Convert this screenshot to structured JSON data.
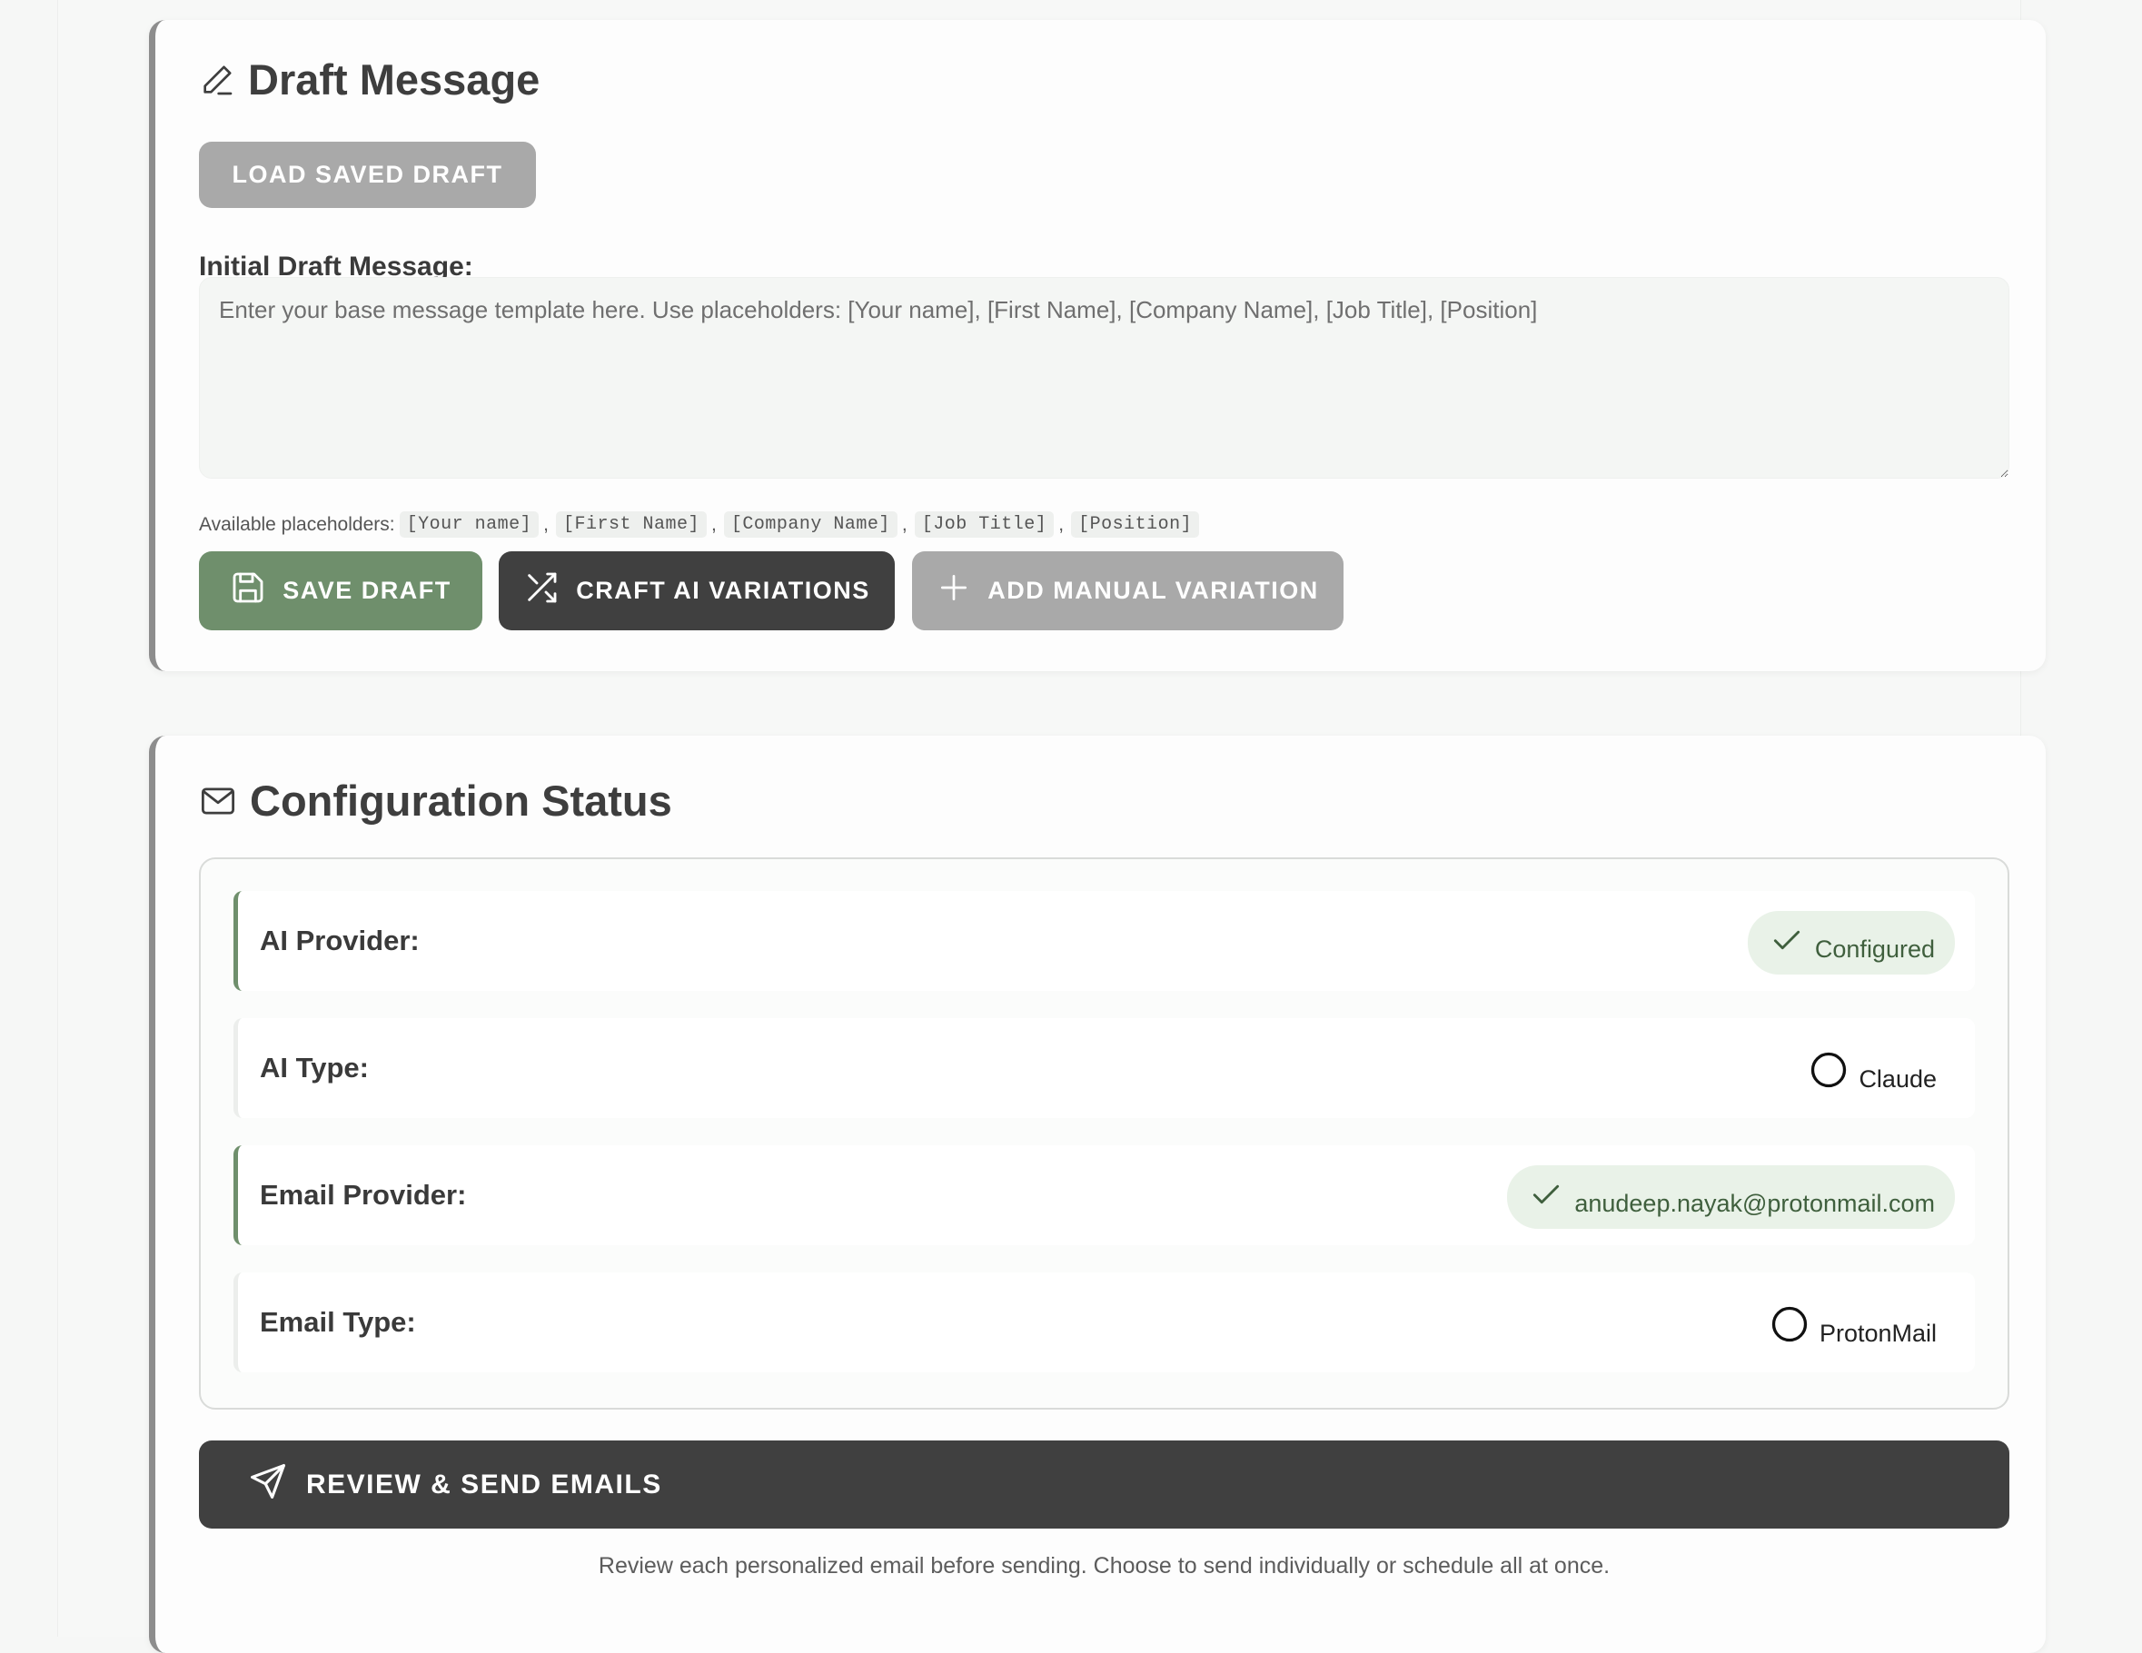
{
  "draft_card": {
    "title": "Draft Message",
    "icon": "pencil-icon",
    "load_button": "LOAD SAVED DRAFT",
    "field_label": "Initial Draft Message:",
    "textarea": {
      "value": "",
      "placeholder": "Enter your base message template here. Use placeholders: [Your name], [First Name], [Company Name], [Job Title], [Position]"
    },
    "placeholders_label": "Available placeholders:",
    "placeholders": [
      "[Your name]",
      "[First Name]",
      "[Company Name]",
      "[Job Title]",
      "[Position]"
    ],
    "separator": ",",
    "buttons": {
      "save": "SAVE DRAFT",
      "craft": "CRAFT AI VARIATIONS",
      "manual": "ADD MANUAL VARIATION"
    }
  },
  "config_card": {
    "title": "Configuration Status",
    "icon": "mail-icon",
    "rows": [
      {
        "label": "AI Provider:",
        "value": "Configured",
        "status": "ok"
      },
      {
        "label": "AI Type:",
        "value": "Claude",
        "status": "neutral"
      },
      {
        "label": "Email Provider:",
        "value": "anudeep.nayak@protonmail.com",
        "status": "ok"
      },
      {
        "label": "Email Type:",
        "value": "ProtonMail",
        "status": "neutral"
      }
    ],
    "review_button": "REVIEW & SEND EMAILS",
    "review_note": "Review each personalized email before sending. Choose to send individually or schedule all at once."
  },
  "colors": {
    "accent_green": "#6f8f6c",
    "dark_button": "#404040",
    "muted_button": "#a9a9a9",
    "success_pill": "#e9f2e8"
  }
}
